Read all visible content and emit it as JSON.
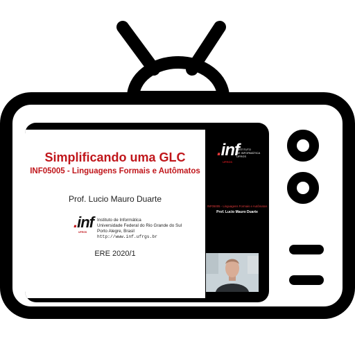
{
  "slide": {
    "title": "Simplificando uma GLC",
    "subtitle": "INF05005 - Linguagens Formais e Autômatos",
    "author": "Prof. Lucio Mauro Duarte",
    "logo_text": ".inf",
    "logo_sub": "UFRGS",
    "institution_lines": [
      "Instituto de Informática",
      "Universidade Federal do Rio Grande do Sul",
      "Porto Alegre, Brasil",
      "http://www.inf.ufrgs.br"
    ],
    "semester": "ERE 2020/1"
  },
  "sidebar": {
    "logo_text": ".inf",
    "logo_sub": "UFRGS",
    "institute_lines": [
      "INSTITUTO",
      "DE INFORMÁTICA",
      "UFRGS"
    ],
    "course": "INF05005 - Linguagens Formais e Autômatos",
    "author": "Prof. Lucio Mauro Duarte"
  },
  "icons": {
    "frame": "tv-icon",
    "antenna": "antenna-icon",
    "knobs": "knob-icon",
    "speaker": "speaker-slot-icon"
  },
  "colors": {
    "frame": "#000000",
    "accent_red": "#c0161b",
    "screen": "#000000",
    "slide_bg": "#ffffff"
  }
}
